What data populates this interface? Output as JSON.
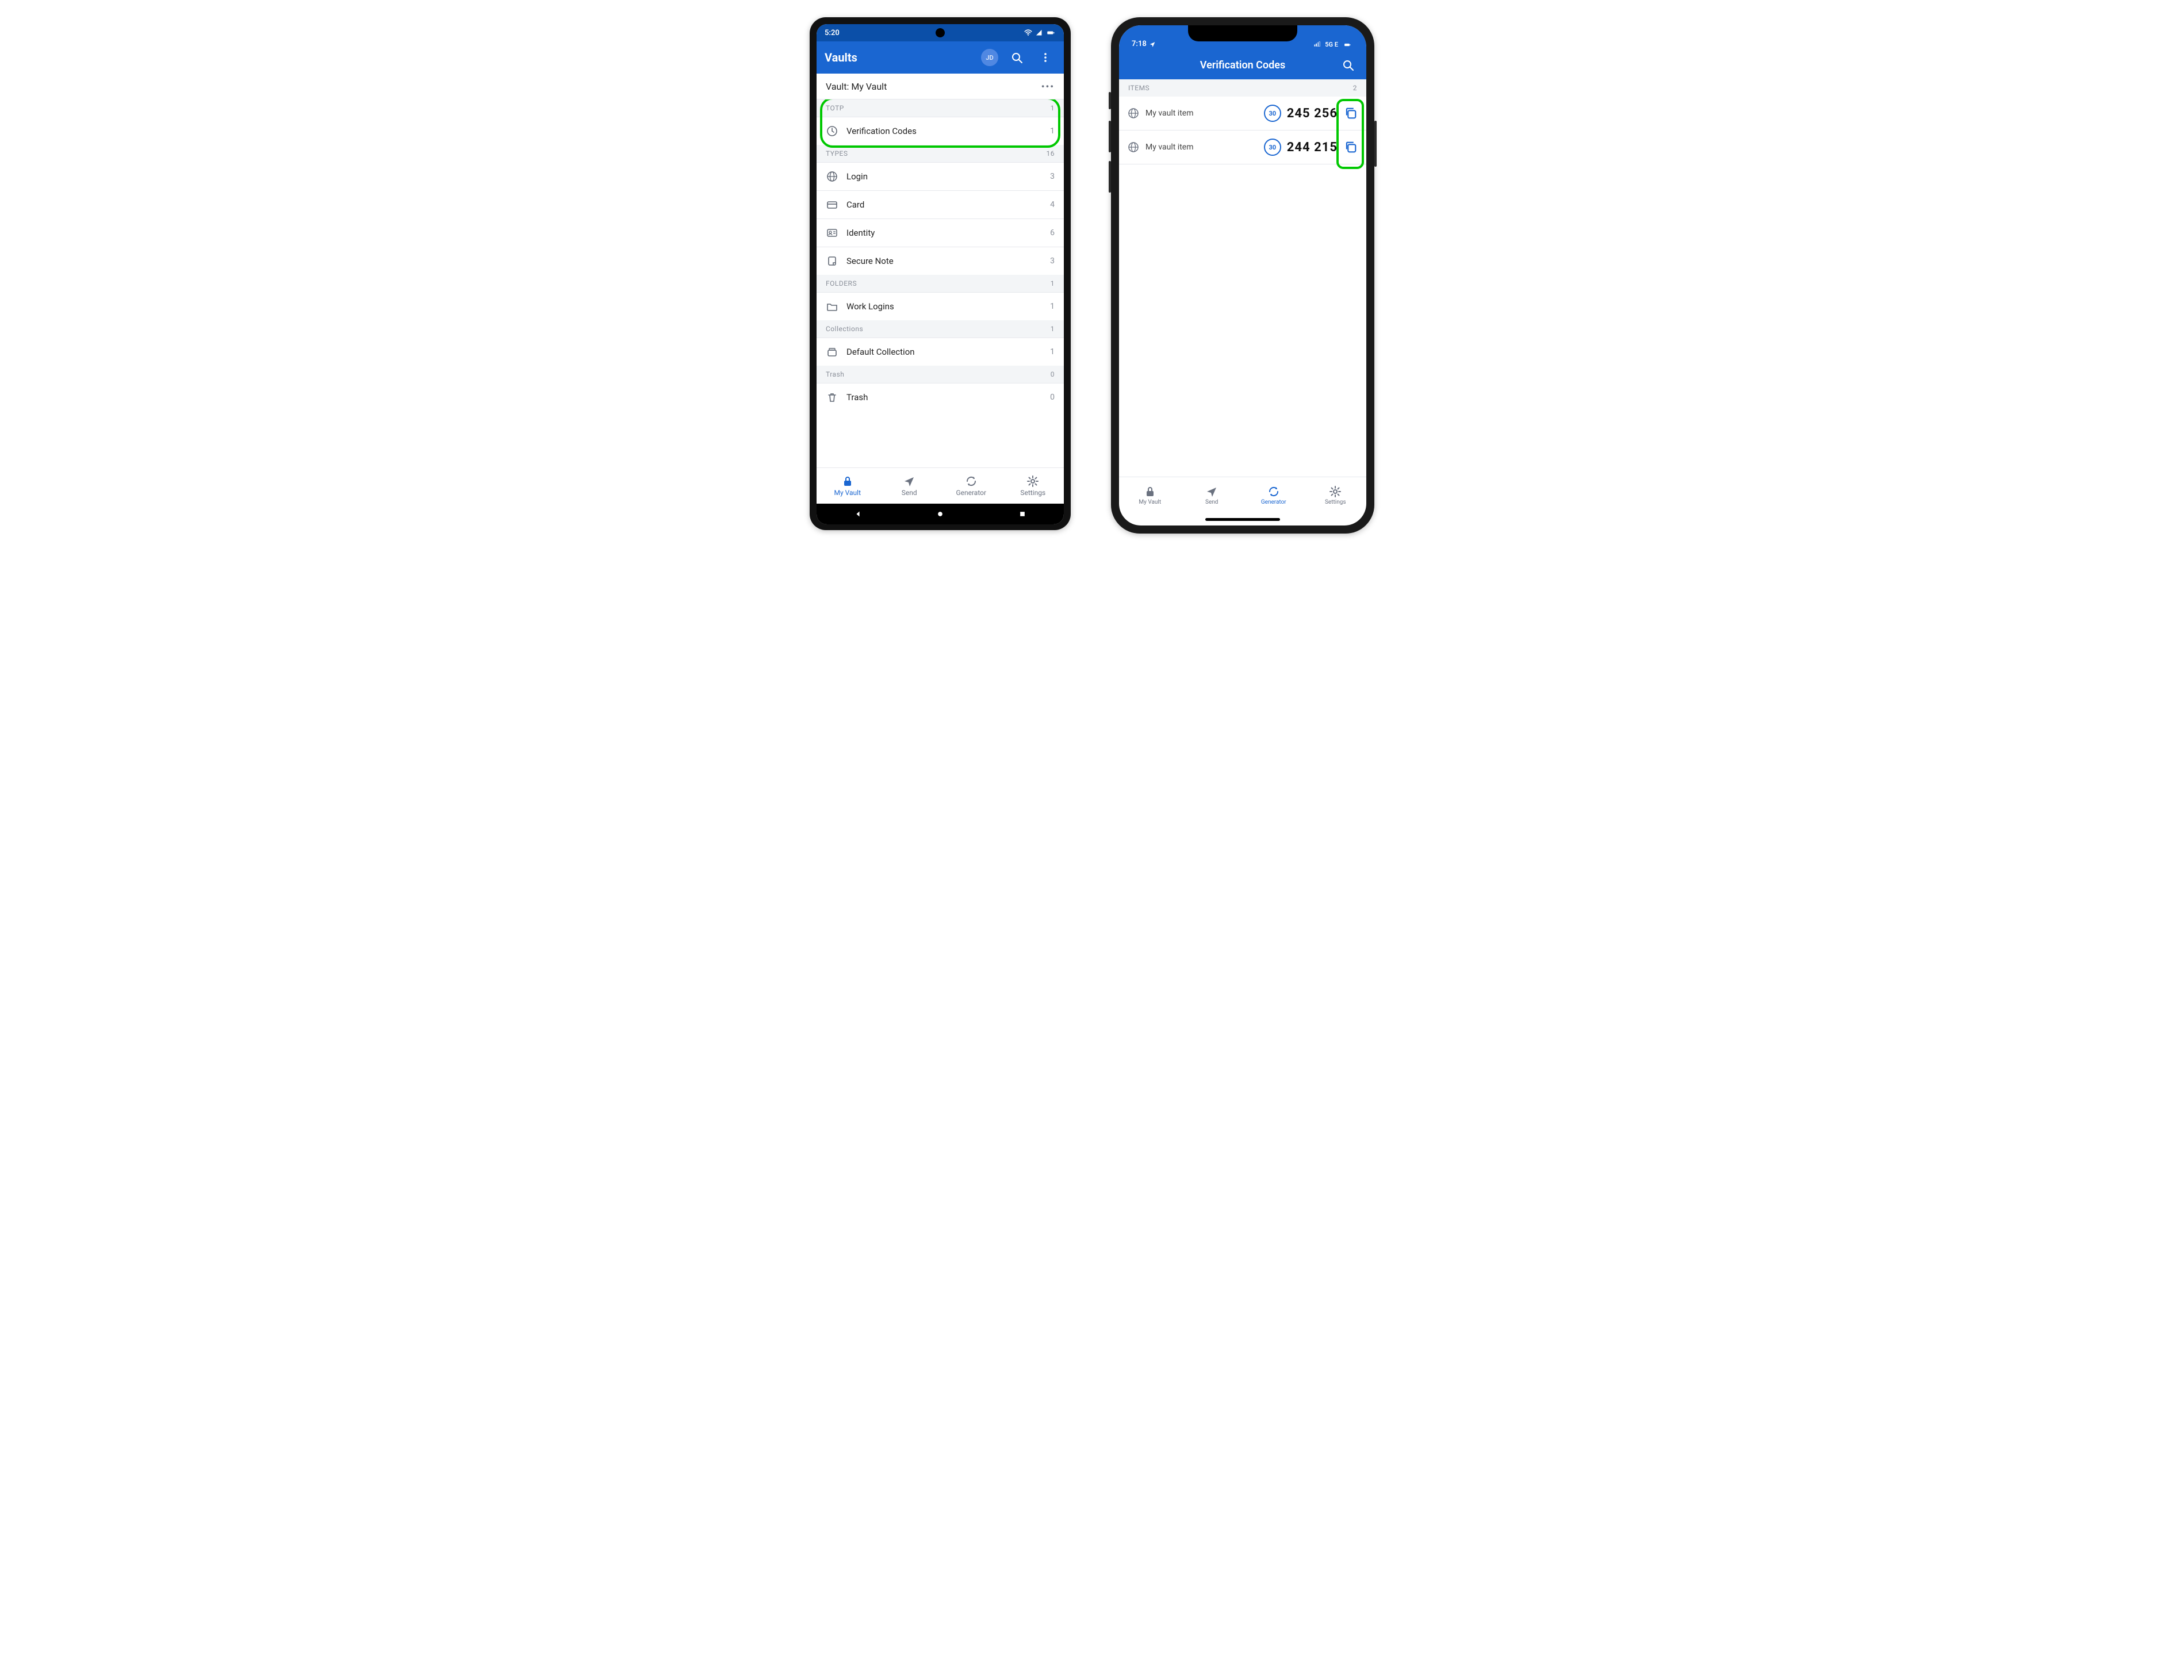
{
  "android": {
    "statusbar": {
      "time": "5:20"
    },
    "appbar": {
      "title": "Vaults",
      "avatar_initials": "JD"
    },
    "vault_selector": {
      "label": "Vault: My Vault"
    },
    "sections": [
      {
        "header": "TOTP",
        "count": "1",
        "rows": [
          {
            "icon": "clock-icon",
            "label": "Verification Codes",
            "count": "1"
          }
        ],
        "highlighted": true
      },
      {
        "header": "TYPES",
        "count": "16",
        "rows": [
          {
            "icon": "globe-icon",
            "label": "Login",
            "count": "3"
          },
          {
            "icon": "card-icon",
            "label": "Card",
            "count": "4"
          },
          {
            "icon": "id-icon",
            "label": "Identity",
            "count": "6"
          },
          {
            "icon": "note-icon",
            "label": "Secure Note",
            "count": "3"
          }
        ]
      },
      {
        "header": "FOLDERS",
        "count": "1",
        "rows": [
          {
            "icon": "folder-icon",
            "label": "Work Logins",
            "count": "1"
          }
        ]
      },
      {
        "header": "Collections",
        "count": "1",
        "rows": [
          {
            "icon": "collection-icon",
            "label": "Default Collection",
            "count": "1"
          }
        ]
      },
      {
        "header": "Trash",
        "count": "0",
        "rows": [
          {
            "icon": "trash-icon",
            "label": "Trash",
            "count": "0"
          }
        ]
      }
    ],
    "tabs": [
      {
        "icon": "lock-icon",
        "label": "My Vault",
        "active": true
      },
      {
        "icon": "send-icon",
        "label": "Send",
        "active": false
      },
      {
        "icon": "refresh-icon",
        "label": "Generator",
        "active": false
      },
      {
        "icon": "gear-icon",
        "label": "Settings",
        "active": false
      }
    ]
  },
  "ios": {
    "statusbar": {
      "time": "7:18",
      "network": "5G E"
    },
    "navtitle": "Verification Codes",
    "section_header": {
      "label": "ITEMS",
      "count": "2"
    },
    "items": [
      {
        "label": "My vault item",
        "countdown": "30",
        "code": "245 256"
      },
      {
        "label": "My vault item",
        "countdown": "30",
        "code": "244 215"
      }
    ],
    "tabs": [
      {
        "icon": "lock-icon",
        "label": "My Vault",
        "active": false
      },
      {
        "icon": "send-icon",
        "label": "Send",
        "active": false
      },
      {
        "icon": "refresh-icon",
        "label": "Generator",
        "active": true
      },
      {
        "icon": "gear-icon",
        "label": "Settings",
        "active": false
      }
    ]
  }
}
